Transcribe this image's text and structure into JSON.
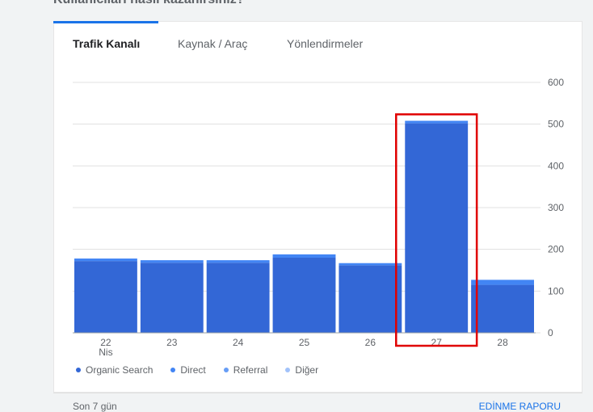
{
  "page": {
    "heading": "Kullanıcıları nasıl kazanırsınız?"
  },
  "tabs": [
    {
      "label": "Trafik Kanalı",
      "active": true
    },
    {
      "label": "Kaynak / Araç",
      "active": false
    },
    {
      "label": "Yönlendirmeler",
      "active": false
    }
  ],
  "footer": {
    "left_text": "Son 7 gün",
    "right_text": "EDİNME RAPORU"
  },
  "colors": {
    "organic": "#3367d6",
    "direct": "#4285f4",
    "referral": "#669df6",
    "other": "#a1c2fa",
    "highlight": "#e00000",
    "grid": "#e0e0e0",
    "accent": "#1a73e8"
  },
  "chart_data": {
    "type": "bar",
    "stacked": true,
    "categories": [
      "22",
      "23",
      "24",
      "25",
      "26",
      "27",
      "28"
    ],
    "category_sublabels": [
      "Nis",
      "",
      "",
      "",
      "",
      "",
      ""
    ],
    "series": [
      {
        "name": "Organic Search",
        "values": [
          172,
          168,
          168,
          180,
          162,
          502,
          115
        ]
      },
      {
        "name": "Direct",
        "values": [
          6,
          6,
          6,
          8,
          5,
          6,
          12
        ]
      },
      {
        "name": "Referral",
        "values": [
          0,
          0,
          0,
          0,
          0,
          0,
          0
        ]
      },
      {
        "name": "Diğer",
        "values": [
          0,
          0,
          0,
          0,
          0,
          0,
          0
        ]
      }
    ],
    "yticks": [
      0,
      100,
      200,
      300,
      400,
      500,
      600
    ],
    "ylim": [
      0,
      600
    ],
    "y_axis_side": "right",
    "grid": true,
    "legend_position": "bottom-left",
    "highlighted_category": "27"
  }
}
